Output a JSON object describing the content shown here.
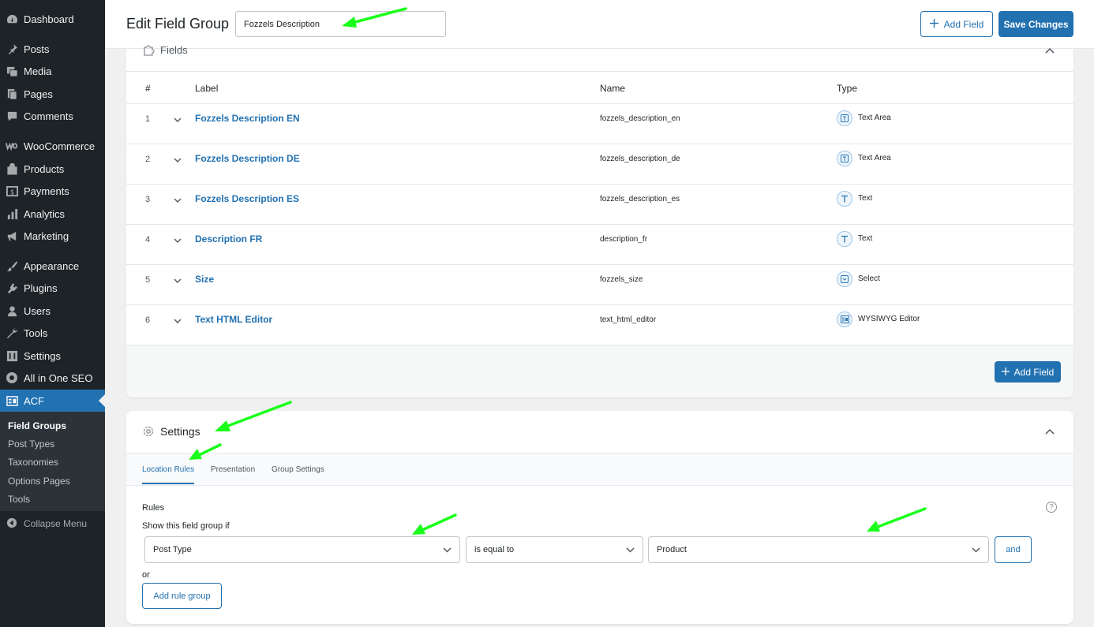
{
  "sidebar": {
    "items": [
      {
        "label": "Dashboard",
        "icon": "dashboard-icon"
      },
      {
        "label": "Posts",
        "icon": "pin-icon"
      },
      {
        "label": "Media",
        "icon": "media-icon"
      },
      {
        "label": "Pages",
        "icon": "pages-icon"
      },
      {
        "label": "Comments",
        "icon": "comment-icon"
      },
      {
        "label": "WooCommerce",
        "icon": "woocommerce-icon"
      },
      {
        "label": "Products",
        "icon": "products-icon"
      },
      {
        "label": "Payments",
        "icon": "payments-icon"
      },
      {
        "label": "Analytics",
        "icon": "analytics-icon"
      },
      {
        "label": "Marketing",
        "icon": "megaphone-icon"
      },
      {
        "label": "Appearance",
        "icon": "brush-icon"
      },
      {
        "label": "Plugins",
        "icon": "plugin-icon"
      },
      {
        "label": "Users",
        "icon": "user-icon"
      },
      {
        "label": "Tools",
        "icon": "wrench-icon"
      },
      {
        "label": "Settings",
        "icon": "settings-icon"
      },
      {
        "label": "All in One SEO",
        "icon": "seo-icon"
      },
      {
        "label": "ACF",
        "icon": "acf-icon"
      }
    ],
    "submenu": [
      "Field Groups",
      "Post Types",
      "Taxonomies",
      "Options Pages",
      "Tools"
    ],
    "collapse_label": "Collapse Menu"
  },
  "header": {
    "title": "Edit Field Group",
    "group_name": "Fozzels Description",
    "add_field_label": "Add Field",
    "save_label": "Save Changes"
  },
  "fields": {
    "section_title": "Fields",
    "columns": {
      "num": "#",
      "label": "Label",
      "name": "Name",
      "type": "Type"
    },
    "rows": [
      {
        "num": "1",
        "label": "Fozzels Description EN",
        "name": "fozzels_description_en",
        "type": "Text Area",
        "icon": "textarea-icon"
      },
      {
        "num": "2",
        "label": "Fozzels Description DE",
        "name": "fozzels_description_de",
        "type": "Text Area",
        "icon": "textarea-icon"
      },
      {
        "num": "3",
        "label": "Fozzels Description ES",
        "name": "fozzels_description_es",
        "type": "Text",
        "icon": "text-icon"
      },
      {
        "num": "4",
        "label": "Description FR",
        "name": "description_fr",
        "type": "Text",
        "icon": "text-icon"
      },
      {
        "num": "5",
        "label": "Size",
        "name": "fozzels_size",
        "type": "Select",
        "icon": "select-icon"
      },
      {
        "num": "6",
        "label": "Text HTML Editor",
        "name": "text_html_editor",
        "type": "WYSIWYG Editor",
        "icon": "wysiwyg-icon"
      }
    ],
    "footer_add_label": "Add Field"
  },
  "settings": {
    "title": "Settings",
    "tabs": [
      {
        "label": "Location Rules",
        "active": true
      },
      {
        "label": "Presentation",
        "active": false
      },
      {
        "label": "Group Settings",
        "active": false
      }
    ],
    "rules_label": "Rules",
    "help": "?",
    "show_if_label": "Show this field group if",
    "rule": {
      "param": "Post Type",
      "operator": "is equal to",
      "value": "Product"
    },
    "and_label": "and",
    "or_label": "or",
    "add_rule_group_label": "Add rule group"
  },
  "colors": {
    "accent": "#2271b1",
    "sidebar": "#1d2327",
    "annotation": "#1aff1a"
  }
}
